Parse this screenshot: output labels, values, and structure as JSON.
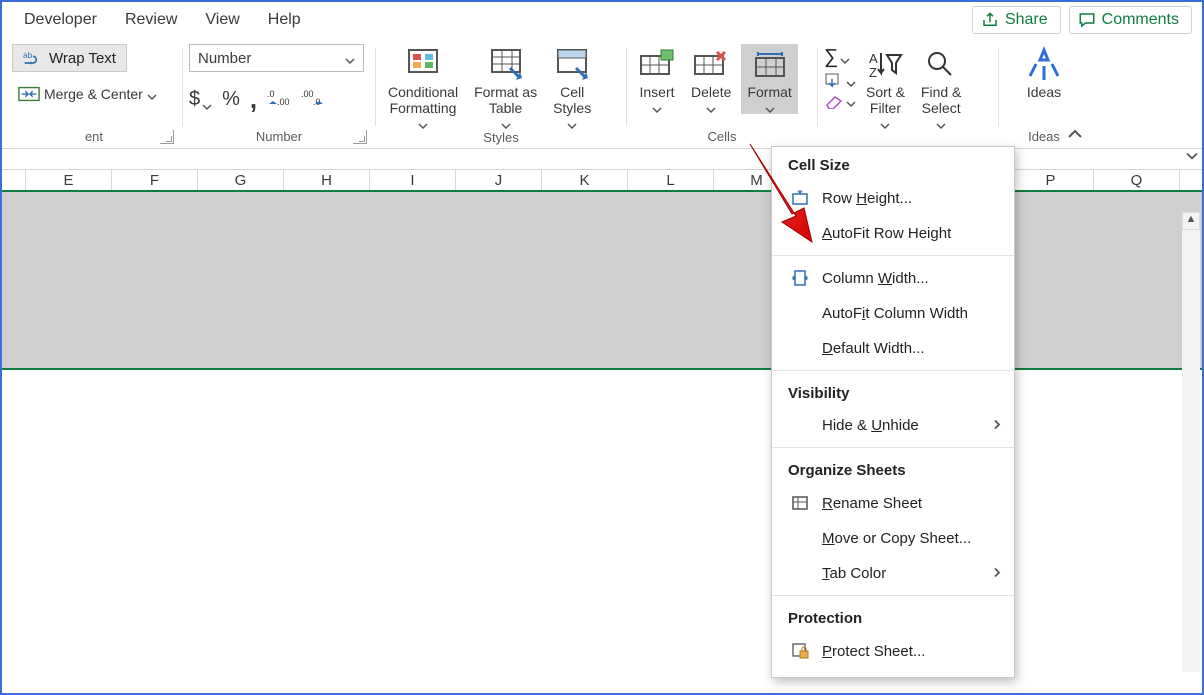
{
  "tabs": {
    "developer": "Developer",
    "review": "Review",
    "view": "View",
    "help": "Help"
  },
  "topright": {
    "share": "Share",
    "comments": "Comments"
  },
  "alignment": {
    "wrap": "Wrap Text",
    "merge": "Merge & Center",
    "group_suffix": "ent"
  },
  "number": {
    "format": "Number",
    "group": "Number"
  },
  "styles": {
    "cond": "Conditional\nFormatting",
    "table": "Format as\nTable",
    "cell": "Cell\nStyles",
    "group": "Styles"
  },
  "cells": {
    "insert": "Insert",
    "delete": "Delete",
    "format": "Format",
    "group": "Cells"
  },
  "editing": {
    "sort": "Sort &\nFilter",
    "find": "Find &\nSelect"
  },
  "ideas": {
    "label": "Ideas",
    "group": "Ideas"
  },
  "columns": [
    "E",
    "F",
    "G",
    "H",
    "I",
    "J",
    "K",
    "L",
    "M",
    "P",
    "Q"
  ],
  "menu": {
    "sect_cellsize": "Cell Size",
    "row_height_pre": "Row ",
    "row_height_u": "H",
    "row_height_post": "eight...",
    "autofit_row_u": "A",
    "autofit_row_post": "utoFit Row Height",
    "col_width_pre": "Column ",
    "col_width_u": "W",
    "col_width_post": "idth...",
    "autofit_col_pre": "AutoF",
    "autofit_col_u": "i",
    "autofit_col_post": "t Column Width",
    "def_width_u": "D",
    "def_width_post": "efault Width...",
    "sect_visibility": "Visibility",
    "hide_pre": "Hide & ",
    "hide_u": "U",
    "hide_post": "nhide",
    "sect_organize": "Organize Sheets",
    "rename_u": "R",
    "rename_post": "ename Sheet",
    "move_u": "M",
    "move_post": "ove or Copy Sheet...",
    "tabcolor_u": "T",
    "tabcolor_post": "ab Color",
    "sect_protection": "Protection",
    "protect_u": "P",
    "protect_post": "rotect Sheet..."
  }
}
